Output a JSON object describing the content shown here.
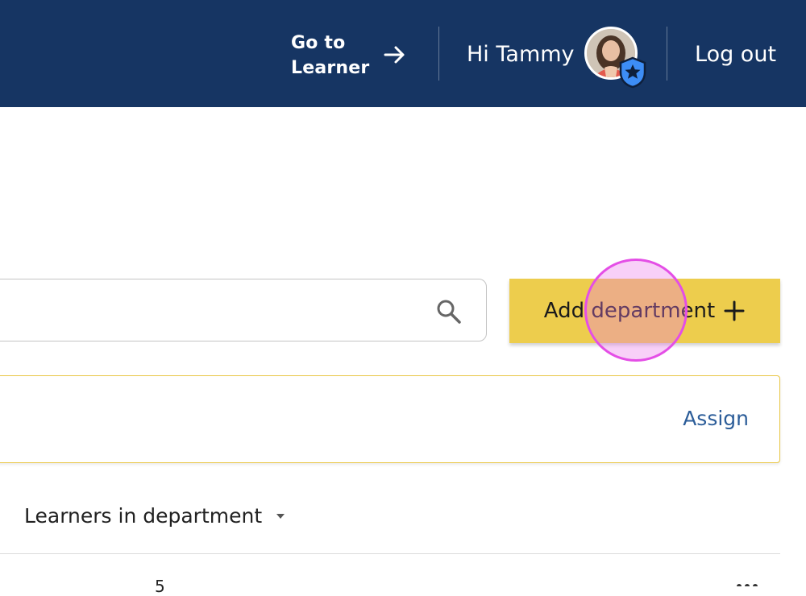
{
  "header": {
    "go_to_learner_label": "Go to Learner",
    "greeting": "Hi Tammy",
    "logout_label": "Log out",
    "avatar_badge_icon": "shield-star-icon"
  },
  "toolbar": {
    "search_placeholder": "",
    "search_icon": "search-icon",
    "add_department_label": "Add department",
    "add_icon": "plus-icon"
  },
  "banner": {
    "assign_label": "Assign"
  },
  "table": {
    "columns": [
      {
        "label": "Learners in department",
        "sort_icon": "caret-down-icon"
      }
    ],
    "rows": [
      {
        "learner_count": "5"
      }
    ]
  },
  "colors": {
    "header_bg": "#163563",
    "accent_yellow": "#edcd4d",
    "link_blue": "#2c5d99",
    "badge_blue": "#3d8df5"
  }
}
